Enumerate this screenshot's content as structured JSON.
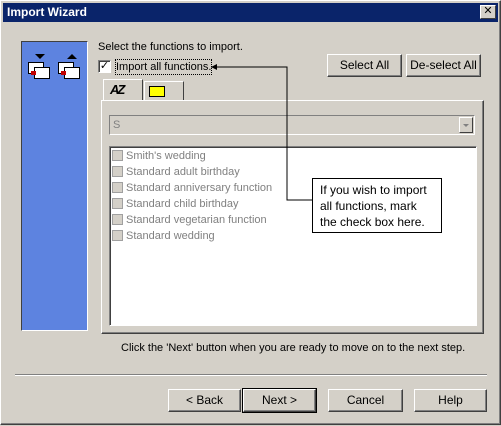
{
  "window": {
    "title": "Import Wizard",
    "close_glyph": "✕"
  },
  "content": {
    "instruction": "Select the functions to import.",
    "import_all_label": "Import all functions.",
    "import_all_checked": true,
    "import_all_check_glyph": "✓",
    "select_all_label": "Select All",
    "deselect_all_label": "De-select All",
    "tabs": [
      {
        "icon": "sort-az-icon",
        "glyph": "AZ"
      },
      {
        "icon": "folder-icon"
      }
    ],
    "filter_value": "S",
    "functions": [
      "Smith's wedding",
      "Standard adult birthday",
      "Standard anniversary function",
      "Standard child birthday",
      "Standard vegetarian function",
      "Standard wedding"
    ],
    "callout_text": "If you wish to import all functions, mark the check box here.",
    "footer_hint": "Click the 'Next' button when you are ready to move on to the next step."
  },
  "buttons": {
    "back": "< Back",
    "next": "Next >",
    "cancel": "Cancel",
    "help": "Help"
  },
  "colors": {
    "titlebar": "#0a246a",
    "side_panel": "#5d83e0",
    "dialog_bg": "#d4d0c8"
  }
}
